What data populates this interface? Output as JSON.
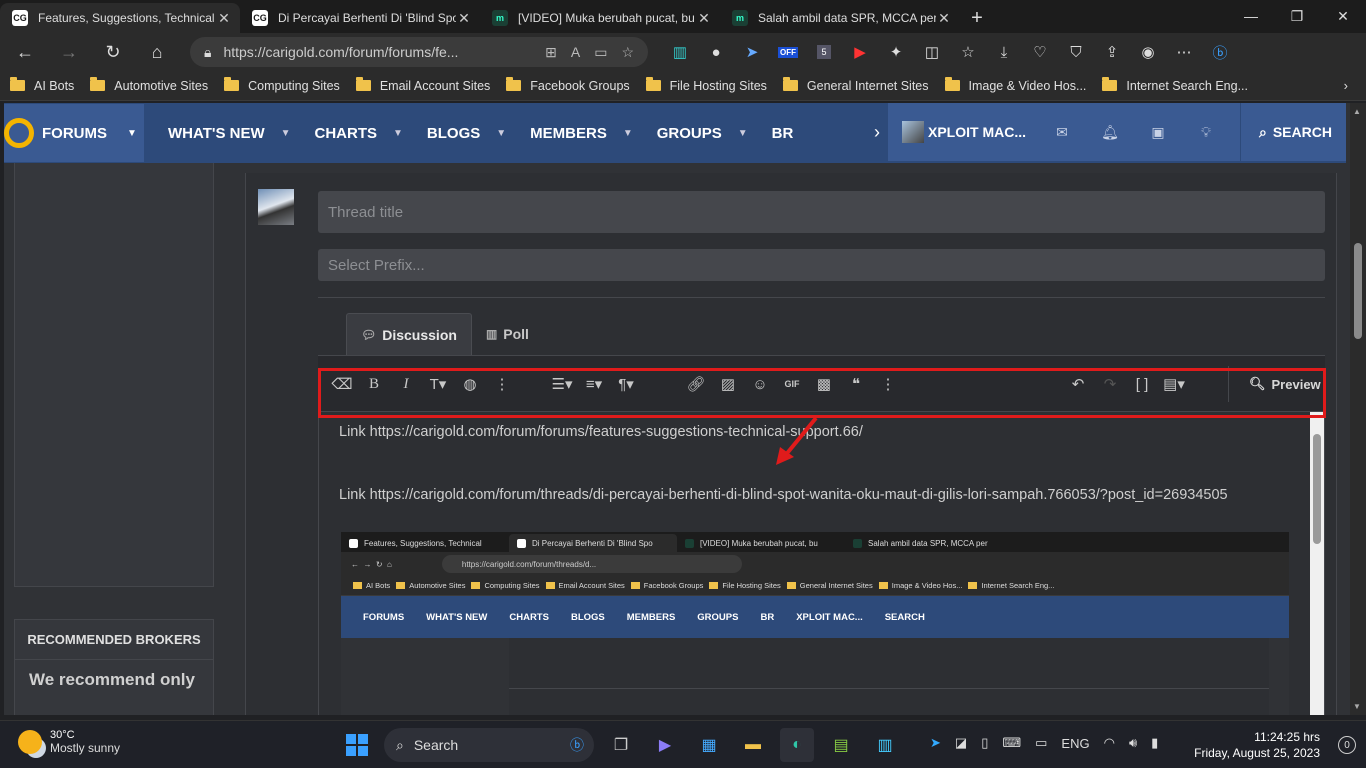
{
  "browser": {
    "tabs": [
      {
        "title": "Features, Suggestions, Technical S",
        "favicon": "carigold-icon",
        "active": true
      },
      {
        "title": "Di Percayai Berhenti Di 'Blind Spo",
        "favicon": "carigold-icon",
        "active": false
      },
      {
        "title": "[VIDEO] Muka berubah pucat, bu",
        "favicon": "mm-icon",
        "active": false
      },
      {
        "title": "Salah ambil data SPR, MCCA per",
        "favicon": "mm-icon",
        "active": false
      }
    ],
    "url": "https://carigold.com/forum/forums/fe...",
    "bookmarks": [
      "AI Bots",
      "Automotive Sites",
      "Computing Sites",
      "Email Account Sites",
      "Facebook Groups",
      "File Hosting Sites",
      "General Internet Sites",
      "Image & Video Hos...",
      "Internet Search Eng..."
    ],
    "off_badge": "OFF",
    "ext_count": "5"
  },
  "forum_nav": {
    "home": "FORUMS",
    "items": [
      "WHAT'S NEW",
      "CHARTS",
      "BLOGS",
      "MEMBERS",
      "GROUPS",
      "BR"
    ],
    "user": "XPLOIT MAC...",
    "search": "SEARCH"
  },
  "sidebar": {
    "brokers_title": "RECOMMENDED BROKERS",
    "brokers_text": "We recommend only"
  },
  "form": {
    "thread_title_placeholder": "Thread title",
    "prefix_placeholder": "Select Prefix...",
    "tabs": [
      "Discussion",
      "Poll"
    ],
    "preview_label": "Preview"
  },
  "editor": {
    "line1": "Link https://carigold.com/forum/forums/features-suggestions-technical-support.66/",
    "line2": "Link https://carigold.com/forum/threads/di-percayai-berhenti-di-blind-spot-wanita-oku-maut-di-gilis-lori-sampah.766053/?post_id=26934505"
  },
  "embedded_screenshot": {
    "tabs": [
      "Features, Suggestions, Technical",
      "Di Percayai Berhenti Di 'Blind Spo",
      "[VIDEO] Muka berubah pucat, bu",
      "Salah ambil data SPR, MCCA per"
    ],
    "url": "https://carigold.com/forum/threads/d...",
    "bookmarks": [
      "AI Bots",
      "Automotive Sites",
      "Computing Sites",
      "Email Account Sites",
      "Facebook Groups",
      "File Hosting Sites",
      "General Internet Sites",
      "Image & Video Hos...",
      "Internet Search Eng..."
    ],
    "nav": [
      "FORUMS",
      "WHAT'S NEW",
      "CHARTS",
      "BLOGS",
      "MEMBERS",
      "GROUPS",
      "BR",
      "XPLOIT MAC...",
      "SEARCH"
    ]
  },
  "taskbar": {
    "temp": "30°C",
    "weather": "Mostly sunny",
    "search": "Search",
    "lang": "ENG",
    "time": "11:24:25 hrs",
    "date": "Friday, August 25, 2023",
    "notifications": "0"
  },
  "colors": {
    "highlight": "#e01b1b",
    "nav_bg": "#2d4a7a",
    "logo": "#f4b400"
  }
}
